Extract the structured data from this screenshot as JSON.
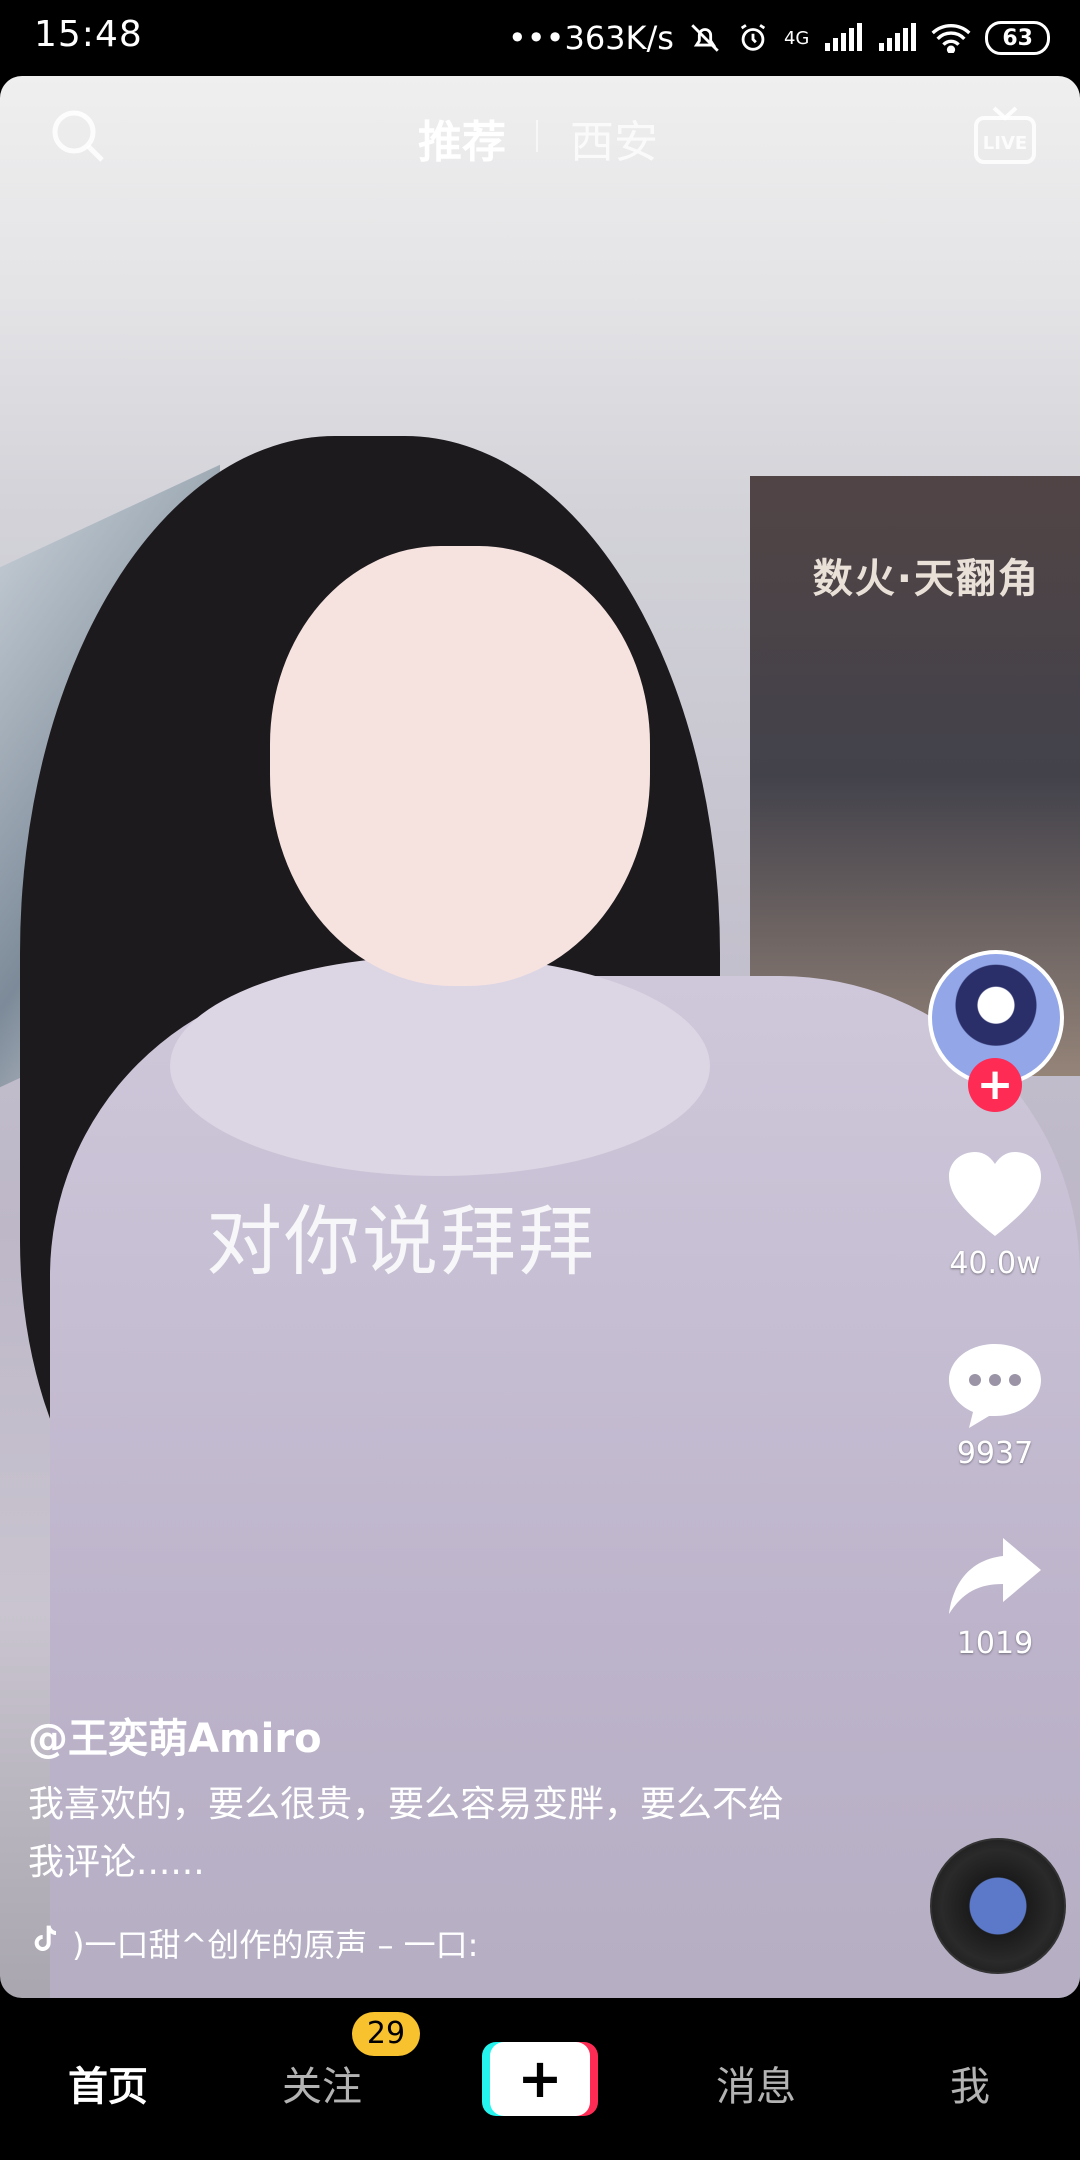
{
  "status_bar": {
    "time": "15:48",
    "network_speed": "•••363K/s",
    "network_type": "4G",
    "battery": "63"
  },
  "top_nav": {
    "tabs": [
      {
        "label": "推荐",
        "active": true
      },
      {
        "label": "西安",
        "active": false
      }
    ],
    "search_icon": "search-icon",
    "live_icon": "LIVE"
  },
  "video": {
    "overlay_caption": "对你说拜拜",
    "store_sign": "数火·天翻角"
  },
  "side_actions": {
    "likes": "40.0w",
    "comments": "9937",
    "shares": "1019"
  },
  "post": {
    "author": "@王奕萌Amiro",
    "description": "我喜欢的，要么很贵，要么容易变胖，要么不给我评论......",
    "music": ")一口甜^创作的原声 – 一口:"
  },
  "bottom_nav": {
    "items": [
      {
        "label": "首页",
        "active": true
      },
      {
        "label": "关注",
        "active": false,
        "badge": "29"
      },
      {
        "label": "+",
        "active": false
      },
      {
        "label": "消息",
        "active": false
      },
      {
        "label": "我",
        "active": false
      }
    ]
  },
  "colors": {
    "accent_red": "#fe2c55",
    "accent_cyan": "#25f4ee",
    "badge_yellow": "#f7c22e"
  }
}
